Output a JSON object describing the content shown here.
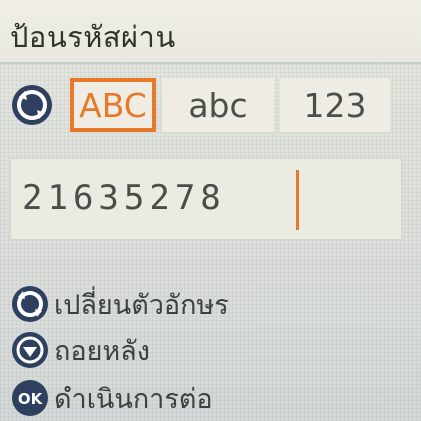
{
  "title": "ป้อนรหัสผ่าน",
  "input_modes": {
    "upper": "ABC",
    "lower": "abc",
    "number": "123",
    "selected": "ABC"
  },
  "entry": {
    "value": "21635278"
  },
  "hints": [
    {
      "icon": "rotate-dial-icon",
      "label": "เปลี่ยนตัวอักษร"
    },
    {
      "icon": "back-icon",
      "label": "ถอยหลัง"
    },
    {
      "icon": "ok-button-icon",
      "label": "ดำเนินการต่อ"
    }
  ],
  "colors": {
    "accent": "#e8792a",
    "icon_blue": "#2e3f5f",
    "background": "#dde0db"
  }
}
